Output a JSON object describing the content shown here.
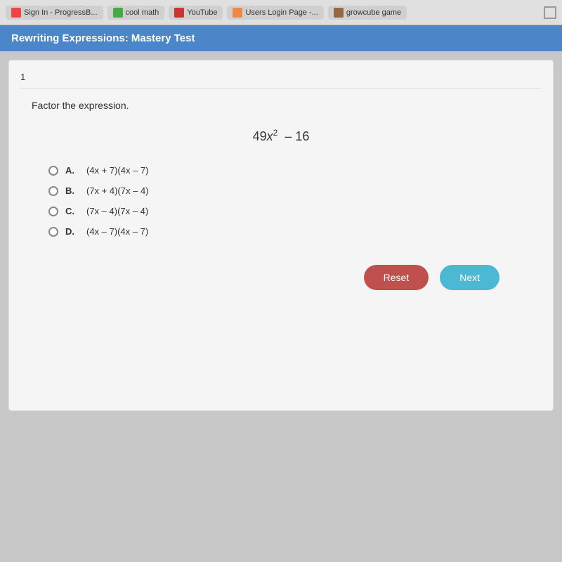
{
  "browser": {
    "tabs": [
      {
        "id": "sign-in",
        "label": "Sign In - ProgressB...",
        "icon_color": "red"
      },
      {
        "id": "cool-math",
        "label": "cool math",
        "icon_color": "green"
      },
      {
        "id": "youtube",
        "label": "YouTube",
        "icon_color": "red-h"
      },
      {
        "id": "users-login",
        "label": "Users Login Page -...",
        "icon_color": "orange"
      },
      {
        "id": "growcube",
        "label": "growcube game",
        "icon_color": "brown"
      }
    ]
  },
  "header": {
    "title": "Rewriting Expressions: Mastery Test"
  },
  "question": {
    "number": "1",
    "prompt": "Factor the expression.",
    "expression_text": "49x² – 16",
    "choices": [
      {
        "id": "A",
        "label": "A.",
        "text": "(4x + 7)(4x – 7)"
      },
      {
        "id": "B",
        "label": "B.",
        "text": "(7x + 4)(7x – 4)"
      },
      {
        "id": "C",
        "label": "C.",
        "text": "(7x – 4)(7x – 4)"
      },
      {
        "id": "D",
        "label": "D.",
        "text": "(4x – 7)(4x – 7)"
      }
    ]
  },
  "buttons": {
    "reset_label": "Reset",
    "next_label": "Next"
  }
}
